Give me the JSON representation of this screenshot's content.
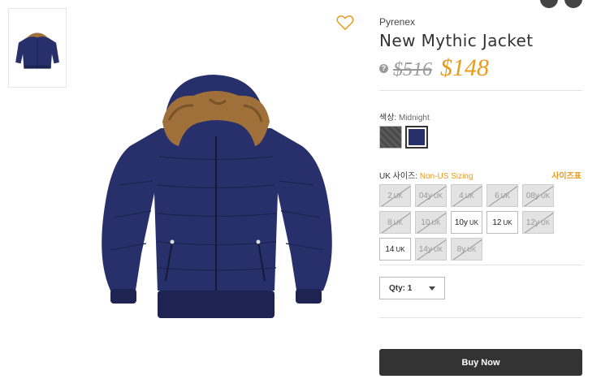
{
  "product": {
    "brand": "Pyrenex",
    "title": "New Mythic Jacket",
    "old_price": "$516",
    "new_price": "$148",
    "help_glyph": "?"
  },
  "color": {
    "label": "색상:",
    "value": "Midnight",
    "swatches": [
      {
        "name": "grey",
        "hex": "#4a4a4a",
        "selected": false
      },
      {
        "name": "Midnight",
        "hex": "#27306a",
        "selected": true
      }
    ]
  },
  "size": {
    "label": "UK 사이즈:",
    "link": "Non-US Sizing",
    "chart_link": "사이즈표",
    "options": [
      {
        "label": "2",
        "unit": "UK",
        "available": false
      },
      {
        "label": "04y",
        "unit": "UK",
        "available": false
      },
      {
        "label": "4",
        "unit": "UK",
        "available": false
      },
      {
        "label": "6",
        "unit": "UK",
        "available": false
      },
      {
        "label": "08y",
        "unit": "UK",
        "available": false
      },
      {
        "label": "8",
        "unit": "UK",
        "available": false
      },
      {
        "label": "10",
        "unit": "UK",
        "available": false
      },
      {
        "label": "10y",
        "unit": "UK",
        "available": true
      },
      {
        "label": "12",
        "unit": "UK",
        "available": true
      },
      {
        "label": "12y",
        "unit": "UK",
        "available": false
      },
      {
        "label": "14",
        "unit": "UK",
        "available": true
      },
      {
        "label": "14y",
        "unit": "UK",
        "available": false
      },
      {
        "label": "8y",
        "unit": "UK",
        "available": false
      }
    ]
  },
  "qty": {
    "label": "Qty: 1"
  },
  "buy": {
    "label": "Buy Now"
  },
  "colors": {
    "accent": "#e89a1b",
    "jacket": "#27306a",
    "fur": "#a0703a"
  }
}
